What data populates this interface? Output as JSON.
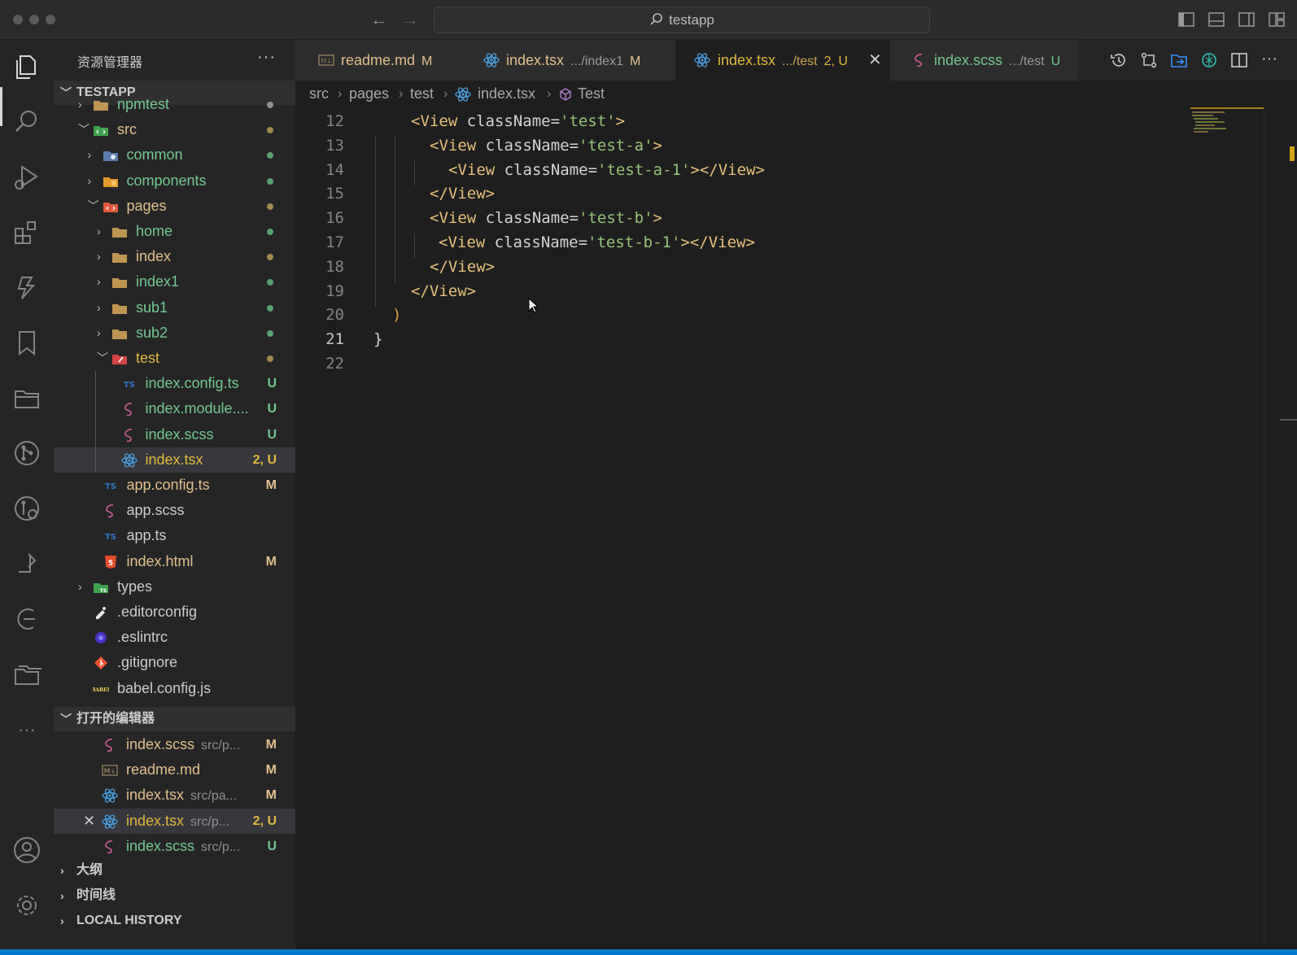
{
  "window": {
    "title": "testapp"
  },
  "sidebar": {
    "title": "资源管理器",
    "more": "···",
    "explorer_section": "TESTAPP",
    "tree": [
      {
        "label": "npmtest",
        "type": "folder",
        "badge": ""
      },
      {
        "label": "src",
        "type": "folder",
        "badge": ""
      },
      {
        "label": "common",
        "type": "folder",
        "badge": ""
      },
      {
        "label": "components",
        "type": "folder",
        "badge": ""
      },
      {
        "label": "pages",
        "type": "folder",
        "badge": ""
      },
      {
        "label": "home",
        "type": "folder",
        "badge": ""
      },
      {
        "label": "index",
        "type": "folder",
        "badge": ""
      },
      {
        "label": "index1",
        "type": "folder",
        "badge": ""
      },
      {
        "label": "sub1",
        "type": "folder",
        "badge": ""
      },
      {
        "label": "sub2",
        "type": "folder",
        "badge": ""
      },
      {
        "label": "test",
        "type": "folder",
        "badge": ""
      },
      {
        "label": "index.config.ts",
        "type": "ts",
        "badge": "U"
      },
      {
        "label": "index.module....",
        "type": "scss",
        "badge": "U"
      },
      {
        "label": "index.scss",
        "type": "scss",
        "badge": "U"
      },
      {
        "label": "index.tsx",
        "type": "react",
        "badge": "2, U"
      },
      {
        "label": "app.config.ts",
        "type": "ts",
        "badge": "M"
      },
      {
        "label": "app.scss",
        "type": "scss",
        "badge": ""
      },
      {
        "label": "app.ts",
        "type": "ts",
        "badge": ""
      },
      {
        "label": "index.html",
        "type": "html",
        "badge": "M"
      },
      {
        "label": "types",
        "type": "folder",
        "badge": ""
      },
      {
        "label": ".editorconfig",
        "type": "editorconfig",
        "badge": ""
      },
      {
        "label": ".eslintrc",
        "type": "eslint",
        "badge": ""
      },
      {
        "label": ".gitignore",
        "type": "git",
        "badge": ""
      },
      {
        "label": "babel.config.js",
        "type": "babel",
        "badge": ""
      }
    ],
    "open_editors_section": "打开的编辑器",
    "open_editors": [
      {
        "label": "index.scss",
        "hint": "src/p...",
        "badge": "M"
      },
      {
        "label": "readme.md",
        "hint": "",
        "badge": "M"
      },
      {
        "label": "index.tsx",
        "hint": "src/pa...",
        "badge": "M"
      },
      {
        "label": "index.tsx",
        "hint": "src/p...",
        "badge": "2, U"
      },
      {
        "label": "index.scss",
        "hint": "src/p...",
        "badge": "U"
      }
    ],
    "outline_section": "大纲",
    "timeline_section": "时间线",
    "local_history_section": "LOCAL HISTORY"
  },
  "tabs": [
    {
      "label": "readme.md",
      "desc": "",
      "status": "M"
    },
    {
      "label": "index.tsx",
      "desc": ".../index1",
      "status": "M"
    },
    {
      "label": "index.tsx",
      "desc": ".../test",
      "status": "2, U"
    },
    {
      "label": "index.scss",
      "desc": ".../test",
      "status": "U"
    }
  ],
  "breadcrumb": [
    "src",
    "pages",
    "test",
    "index.tsx",
    "Test"
  ],
  "editor": {
    "lines": [
      {
        "n": "12",
        "indent": 2,
        "tokens": [
          [
            "tag",
            "<View "
          ],
          [
            "attr",
            "className="
          ],
          [
            "str",
            "'test'"
          ],
          [
            "tag",
            ">"
          ]
        ]
      },
      {
        "n": "13",
        "indent": 3,
        "tokens": [
          [
            "tag",
            "<View "
          ],
          [
            "attr",
            "className="
          ],
          [
            "str",
            "'test-a'"
          ],
          [
            "tag",
            ">"
          ]
        ]
      },
      {
        "n": "14",
        "indent": 4,
        "tokens": [
          [
            "tag",
            "<View "
          ],
          [
            "attr",
            "className="
          ],
          [
            "str",
            "'test-a-1'"
          ],
          [
            "tag",
            "></View>"
          ]
        ]
      },
      {
        "n": "15",
        "indent": 3,
        "tokens": [
          [
            "tag",
            "</View>"
          ]
        ]
      },
      {
        "n": "16",
        "indent": 3,
        "tokens": [
          [
            "tag",
            "<View "
          ],
          [
            "attr",
            "className="
          ],
          [
            "str",
            "'test-b'"
          ],
          [
            "tag",
            ">"
          ]
        ]
      },
      {
        "n": "17",
        "indent": 3.5,
        "tokens": [
          [
            "tag",
            "<View "
          ],
          [
            "attr",
            "className="
          ],
          [
            "str",
            "'test-b-1'"
          ],
          [
            "tag",
            "></View>"
          ]
        ]
      },
      {
        "n": "18",
        "indent": 3,
        "tokens": [
          [
            "tag",
            "</View>"
          ]
        ]
      },
      {
        "n": "19",
        "indent": 2,
        "tokens": [
          [
            "tag",
            "</View>"
          ]
        ]
      },
      {
        "n": "20",
        "indent": 1,
        "tokens": [
          [
            "paren",
            ")"
          ]
        ]
      },
      {
        "n": "21",
        "indent": 0,
        "tokens": [
          [
            "brace",
            "}"
          ]
        ]
      },
      {
        "n": "22",
        "indent": 0,
        "tokens": []
      }
    ],
    "current_line": "21"
  },
  "colors": {
    "accent": "#007acc",
    "modified": "#e2c08d",
    "untracked": "#73c991",
    "warning": "#e2b93d"
  }
}
